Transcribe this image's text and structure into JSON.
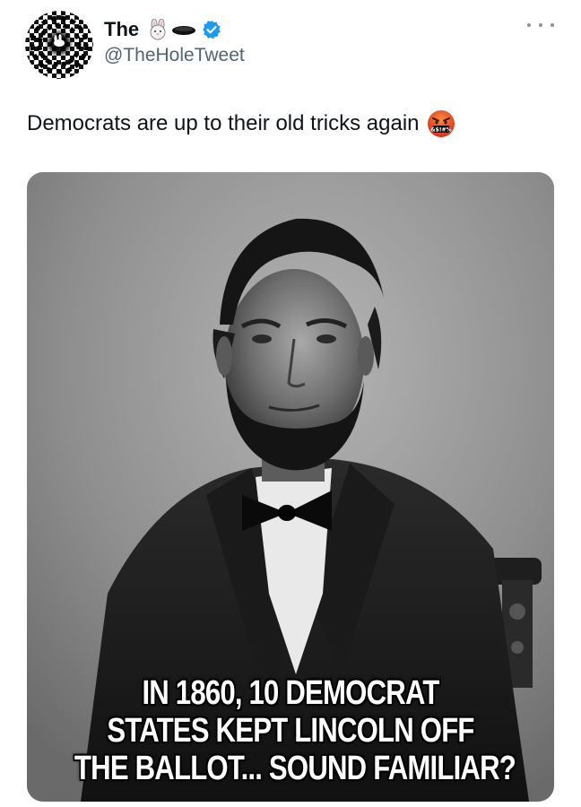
{
  "author": {
    "display_name": "The",
    "name_emojis": [
      "rabbit-face-icon",
      "hole-icon"
    ],
    "verified": true,
    "verified_color": "#1d9bf0",
    "handle": "@TheHoleTweet",
    "avatar": "spiral-hole-rabbit-avatar"
  },
  "more_menu_icon": "ellipsis-icon",
  "tweet": {
    "text": "Democrats are up to their old tricks again",
    "trailing_emoji": "face-with-symbols-on-mouth-icon"
  },
  "media": {
    "image": "black-and-white-portrait-of-abraham-lincoln",
    "caption_lines": [
      "IN 1860, 10 DEMOCRAT",
      "STATES KEPT LINCOLN OFF",
      "THE BALLOT... SOUND FAMILIAR?"
    ]
  },
  "colors": {
    "text_primary": "#0f1419",
    "text_secondary": "#536471"
  }
}
